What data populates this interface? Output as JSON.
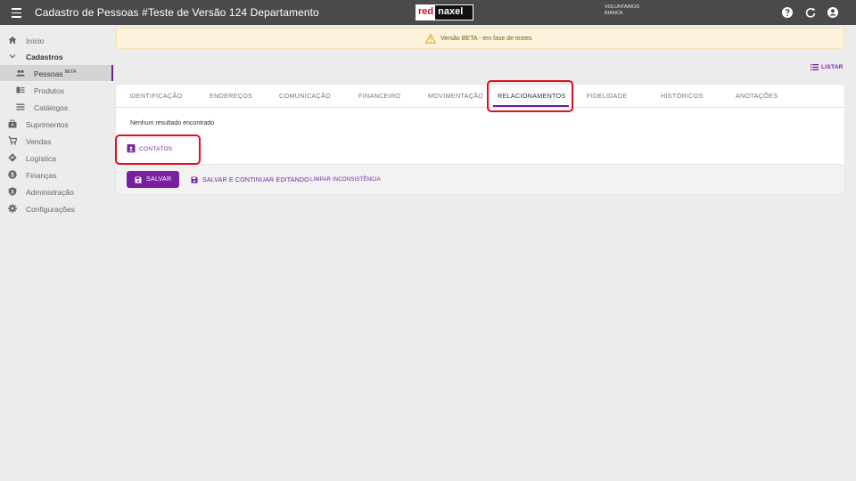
{
  "header": {
    "title": "Cadastro de Pessoas #Teste de Versão 124 Departamento",
    "logo": {
      "part1": "red",
      "part2": "naxel"
    },
    "user": {
      "line1": "VOLUNTARIOS",
      "line2": "BIANCA"
    }
  },
  "sidebar": {
    "items": [
      {
        "label": "Início",
        "icon": "home-icon"
      },
      {
        "label": "Cadastros",
        "icon": "chevron-down-icon"
      },
      {
        "label": "Pessoas",
        "badge": "BETA",
        "icon": "people-icon"
      },
      {
        "label": "Produtos",
        "icon": "products-icon"
      },
      {
        "label": "Catálogos",
        "icon": "list-icon"
      },
      {
        "label": "Suprimentos",
        "icon": "supplies-icon"
      },
      {
        "label": "Vendas",
        "icon": "cart-icon"
      },
      {
        "label": "Logística",
        "icon": "route-icon"
      },
      {
        "label": "Finanças",
        "icon": "dollar-icon"
      },
      {
        "label": "Administração",
        "icon": "shield-icon"
      },
      {
        "label": "Configurações",
        "icon": "gear-icon"
      }
    ]
  },
  "banner": {
    "text": "Versão BETA - em fase de testes"
  },
  "listar": {
    "label": "LISTAR"
  },
  "tabs": [
    {
      "label": "IDENTIFICAÇÃO"
    },
    {
      "label": "ENDEREÇOS"
    },
    {
      "label": "COMUNICAÇÃO"
    },
    {
      "label": "FINANCEIRO"
    },
    {
      "label": "MOVIMENTAÇÃO"
    },
    {
      "label": "RELACIONAMENTOS"
    },
    {
      "label": "FIDELIDADE"
    },
    {
      "label": "HISTÓRICOS"
    },
    {
      "label": "ANOTAÇÕES"
    }
  ],
  "active_tab": "RELACIONAMENTOS",
  "content": {
    "empty_message": "Nenhum resultado encontrado",
    "contatos_label": "CONTATOS"
  },
  "actions": {
    "save": "SALVAR",
    "save_continue": "SALVAR E CONTINUAR EDITANDO",
    "clear": "LIMPAR INCONSISTÊNCIA"
  },
  "colors": {
    "accent": "#7b1fa2",
    "topbar": "#4a4a4a",
    "banner_bg": "#fdf3dc",
    "highlight": "#e0101c"
  }
}
